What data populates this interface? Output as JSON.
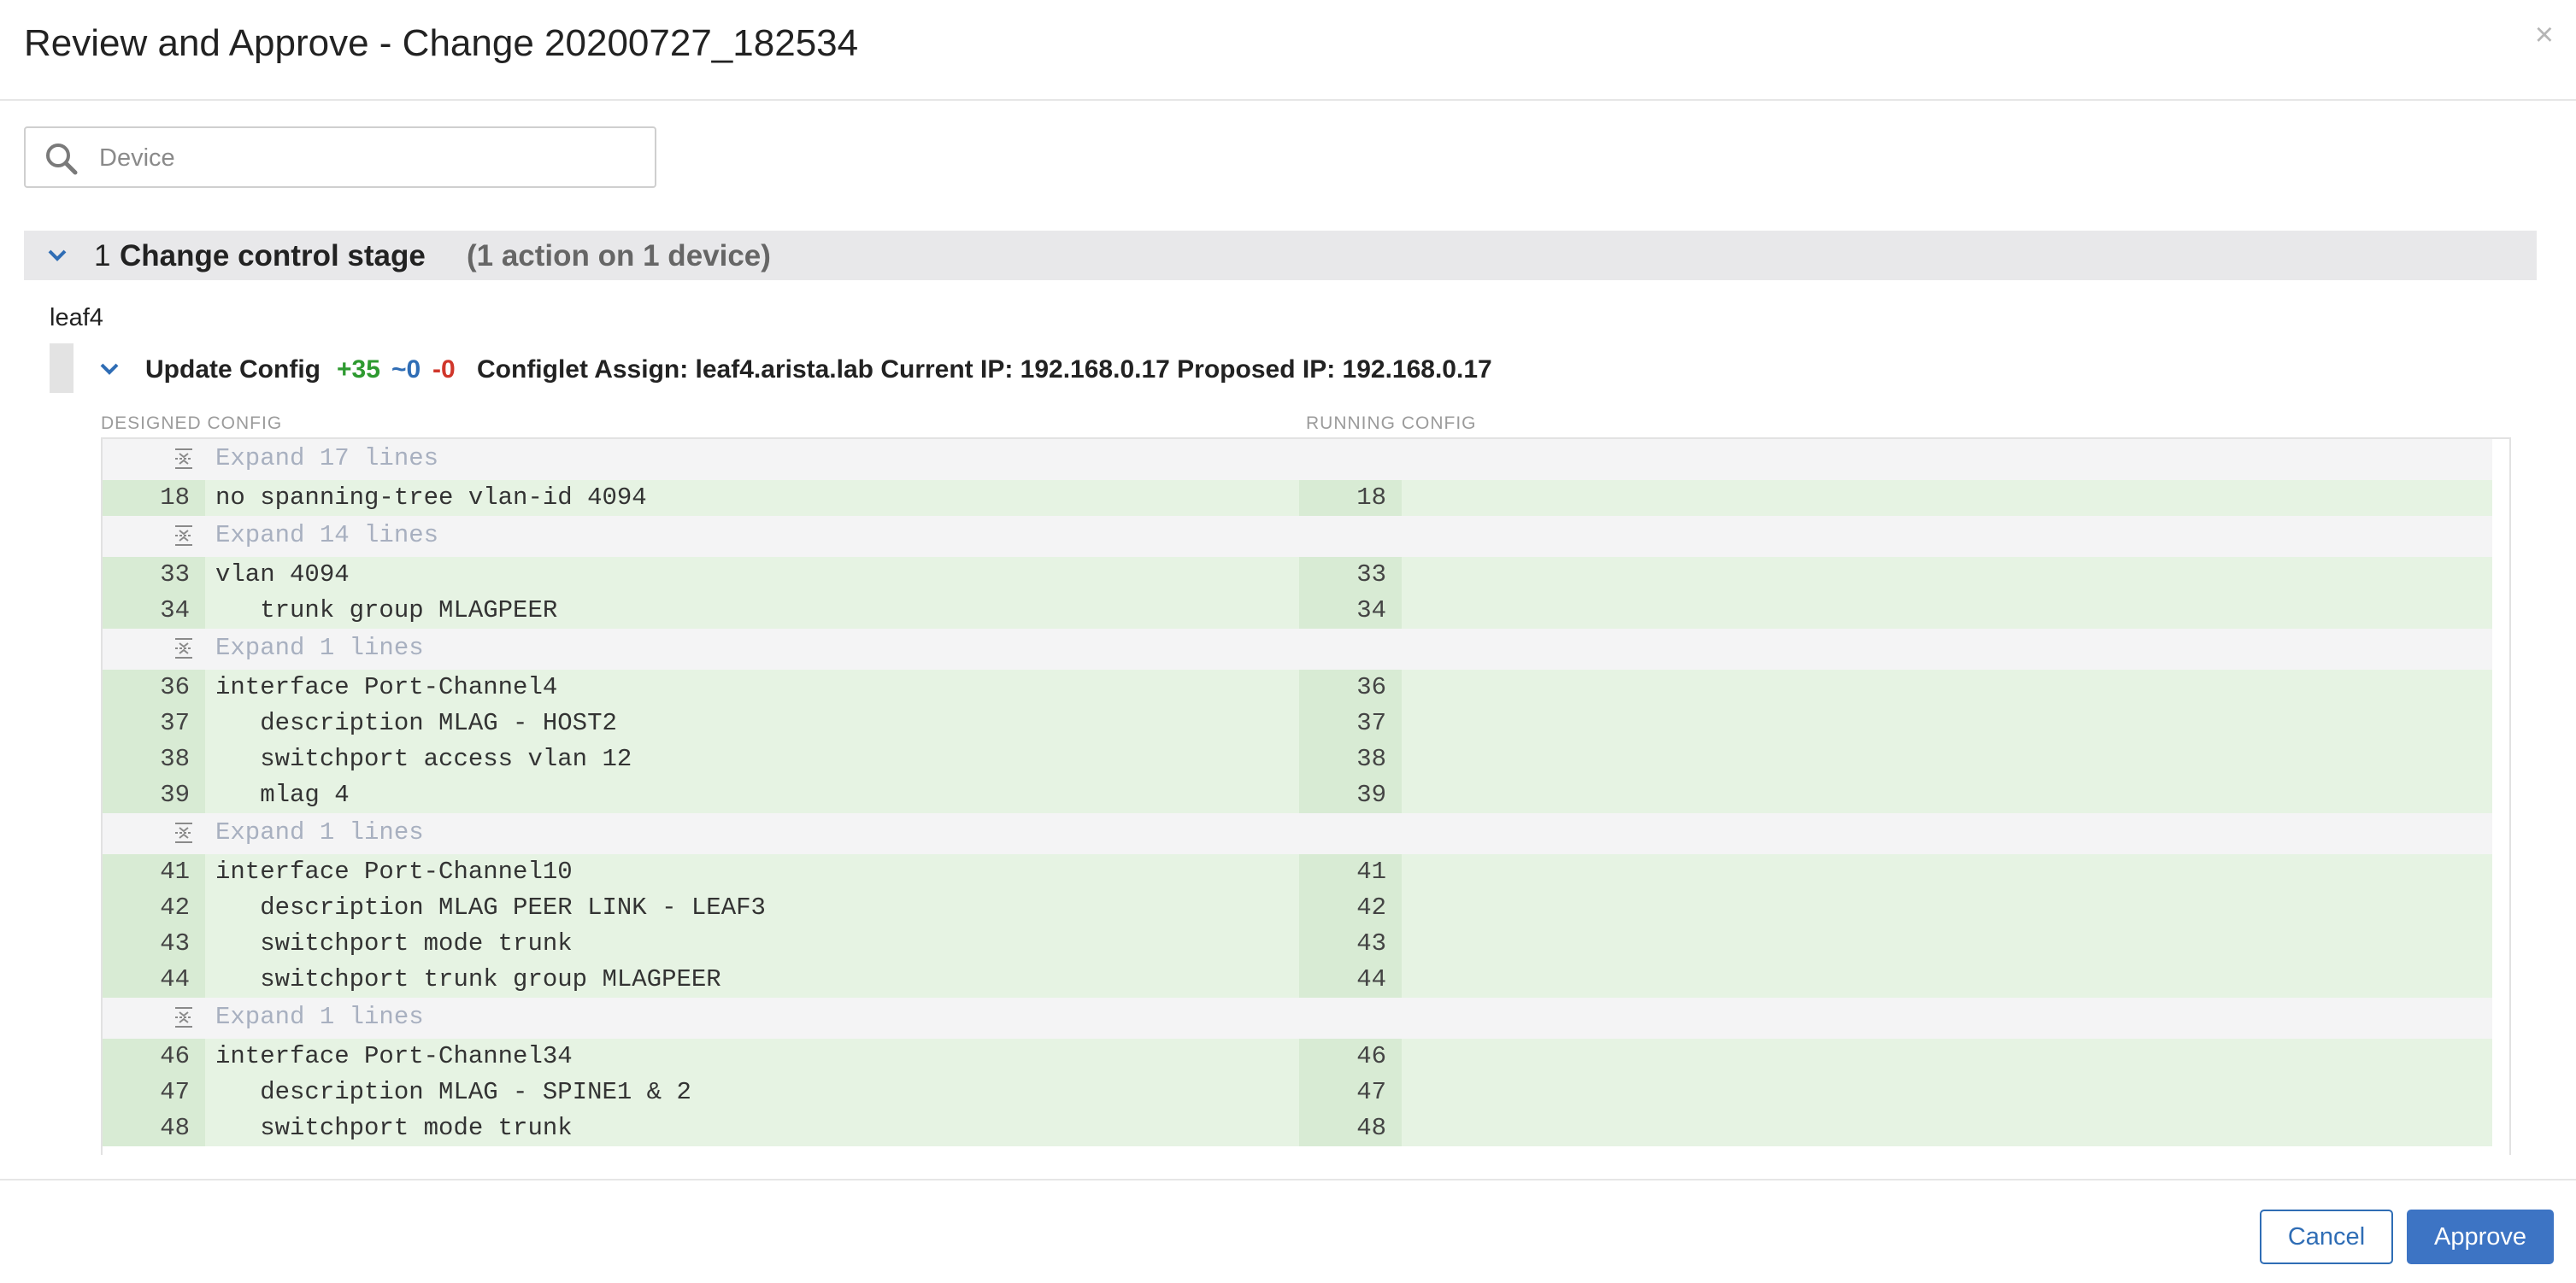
{
  "modal": {
    "title": "Review and Approve - Change 20200727_182534",
    "close": "×"
  },
  "search": {
    "placeholder": "Device",
    "value": ""
  },
  "stage": {
    "number": "1",
    "label": "Change control stage",
    "summary": "(1 action on 1 device)"
  },
  "device": {
    "name": "leaf4"
  },
  "action": {
    "name": "Update Config",
    "added": "+35",
    "modified": "~0",
    "removed": "-0",
    "detail": "Configlet Assign: leaf4.arista.lab Current IP: 192.168.0.17 Proposed IP: 192.168.0.17"
  },
  "diff": {
    "left_header": "DESIGNED CONFIG",
    "right_header": "RUNNING CONFIG",
    "rows": [
      {
        "type": "expand",
        "text": "Expand 17 lines"
      },
      {
        "type": "code",
        "left": "18",
        "right": "18",
        "text": "no spanning-tree vlan-id 4094"
      },
      {
        "type": "expand",
        "text": "Expand 14 lines"
      },
      {
        "type": "code",
        "left": "33",
        "right": "33",
        "text": "vlan 4094"
      },
      {
        "type": "code",
        "left": "34",
        "right": "34",
        "text": "   trunk group MLAGPEER"
      },
      {
        "type": "expand",
        "text": "Expand 1 lines"
      },
      {
        "type": "code",
        "left": "36",
        "right": "36",
        "text": "interface Port-Channel4"
      },
      {
        "type": "code",
        "left": "37",
        "right": "37",
        "text": "   description MLAG - HOST2"
      },
      {
        "type": "code",
        "left": "38",
        "right": "38",
        "text": "   switchport access vlan 12"
      },
      {
        "type": "code",
        "left": "39",
        "right": "39",
        "text": "   mlag 4"
      },
      {
        "type": "expand",
        "text": "Expand 1 lines"
      },
      {
        "type": "code",
        "left": "41",
        "right": "41",
        "text": "interface Port-Channel10"
      },
      {
        "type": "code",
        "left": "42",
        "right": "42",
        "text": "   description MLAG PEER LINK - LEAF3"
      },
      {
        "type": "code",
        "left": "43",
        "right": "43",
        "text": "   switchport mode trunk"
      },
      {
        "type": "code",
        "left": "44",
        "right": "44",
        "text": "   switchport trunk group MLAGPEER"
      },
      {
        "type": "expand",
        "text": "Expand 1 lines"
      },
      {
        "type": "code",
        "left": "46",
        "right": "46",
        "text": "interface Port-Channel34"
      },
      {
        "type": "code",
        "left": "47",
        "right": "47",
        "text": "   description MLAG - SPINE1 & 2"
      },
      {
        "type": "code",
        "left": "48",
        "right": "48",
        "text": "   switchport mode trunk"
      }
    ]
  },
  "footer": {
    "cancel": "Cancel",
    "approve": "Approve"
  },
  "colors": {
    "accent": "#3d74c4",
    "added": "#2e9a30",
    "modified": "#2f6db5",
    "removed": "#d0362b",
    "diff_bg": "#e6f3e3"
  }
}
